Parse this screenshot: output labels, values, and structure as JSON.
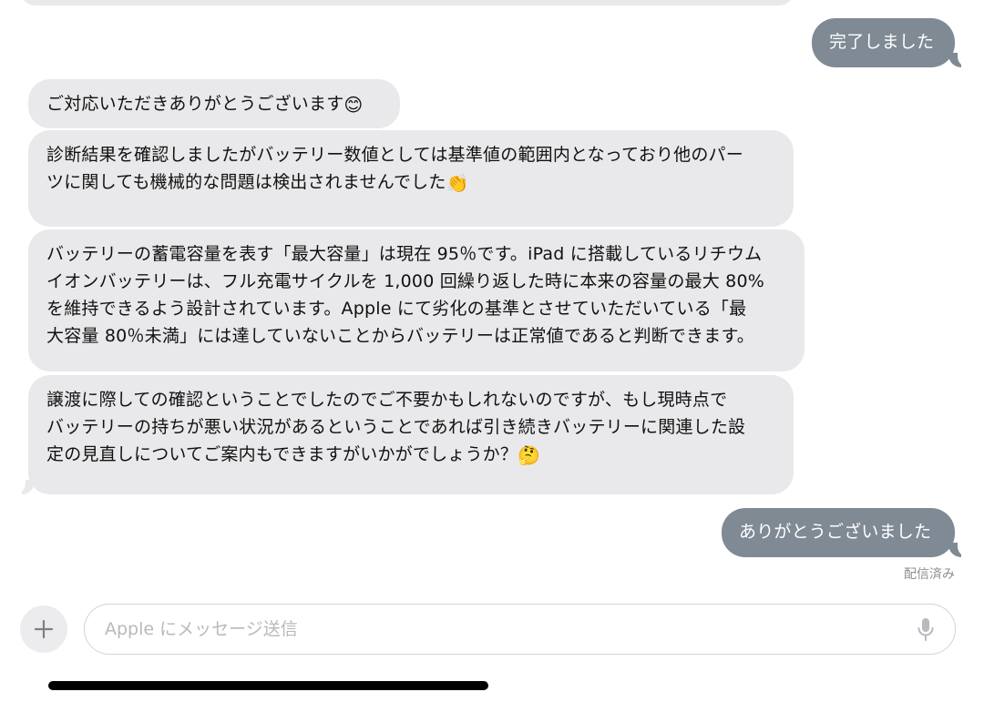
{
  "messages": [
    {
      "id": "m1",
      "direction": "outgoing",
      "text": "完了しました"
    },
    {
      "id": "m2",
      "direction": "incoming",
      "text": "ご対応いただきありがとうございます",
      "emoji": "😊"
    },
    {
      "id": "m3",
      "direction": "incoming",
      "lines": [
        "診断結果を確認しましたがバッテリー数値としては基準値の範囲内となっており他のパー",
        "ツに関しても機械的な問題は検出されませんでした"
      ],
      "emoji": "👏"
    },
    {
      "id": "m4",
      "direction": "incoming",
      "lines": [
        "バッテリーの蓄電容量を表す「最大容量」は現在 95％です。iPad に搭載しているリチウム",
        "イオンバッテリーは、フル充電サイクルを 1,000 回繰り返した時に本来の容量の最大 80%",
        "を維持できるよう設計されています。Apple にて劣化の基準とさせていただいている「最",
        "大容量 80％未満」には達していないことからバッテリーは正常値であると判断できます。"
      ]
    },
    {
      "id": "m5",
      "direction": "incoming",
      "lines": [
        "譲渡に際しての確認ということでしたのでご不要かもしれないのですが、もし現時点で",
        "バッテリーの持ちが悪い状況があるということであれば引き続きバッテリーに関連した設",
        "定の見直しについてご案内もできますがいかがでしょうか？"
      ],
      "emoji": "🤔"
    },
    {
      "id": "m6",
      "direction": "outgoing",
      "text": "ありがとうございました"
    }
  ],
  "status": "配信済み",
  "composer": {
    "placeholder": "Apple にメッセージ送信",
    "add_icon": "plus-icon",
    "mic_icon": "microphone-icon"
  },
  "colors": {
    "incoming_bubble": "#e9e9eb",
    "outgoing_bubble": "#7f8a95",
    "status_text": "#8e8e93",
    "placeholder_text": "#b9b9be"
  }
}
